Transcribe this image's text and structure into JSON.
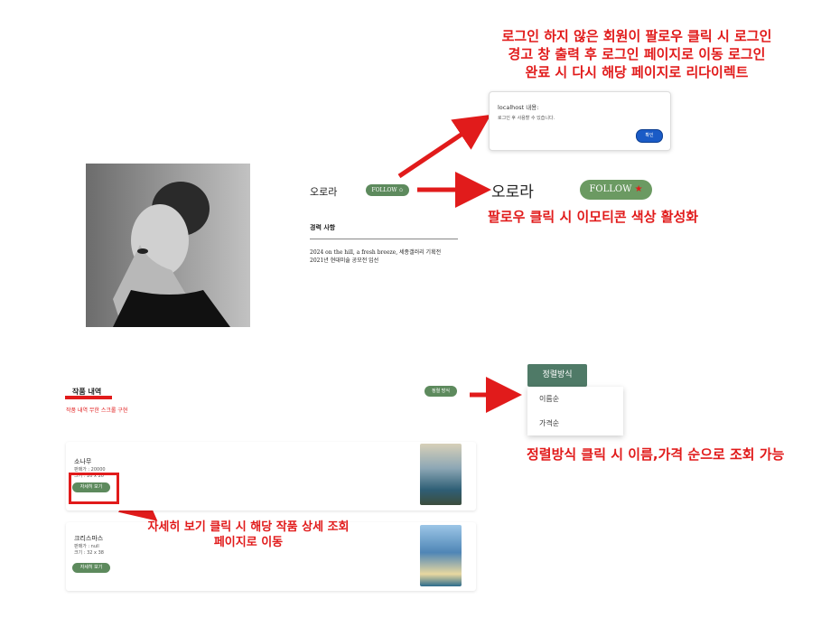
{
  "notes": {
    "login_warning": [
      "로그인 하지 않은 회원이 팔로우 클릭 시 로그인",
      "경고 창 출력 후 로그인 페이지로 이동 로그인",
      "완료 시 다시 해당 페이지로 리다이렉트"
    ],
    "follow_activate": "팔로우 클릭 시 이모티콘 색상 활성화",
    "sort_note": "정렬방식 클릭 시 이름,가격 순으로 조회 가능",
    "detail_note": [
      "자세히 보기 클릭 시 해당 작품 상세 조회",
      "페이지로 이동"
    ]
  },
  "profile": {
    "name": "오로라",
    "follow_label": "FOLLOW ✩",
    "career_heading": "경력 사항",
    "career_lines": [
      "2024 on the hill, a fresh breeze, 세종갤러리 기획전",
      "2021년 현대미술 공모전 입선"
    ]
  },
  "modal": {
    "title": "localhost 내용:",
    "message": "로그인 후 사용할 수 있습니다.",
    "confirm": "확인"
  },
  "follow_active": {
    "name": "오로라",
    "label": "FOLLOW",
    "star": "★"
  },
  "works": {
    "title": "작품 내역",
    "subtitle": "작품 내역 무한 스크롤 구현",
    "sort_small": "정렬 방식",
    "sort_button": "정렬방식",
    "sort_options": [
      "이름순",
      "가격순"
    ],
    "items": [
      {
        "title": "소나무",
        "meta1": "판매가 : 20000",
        "meta2": "크기 : 20 x 20",
        "button": "자세히 보기"
      },
      {
        "title": "크리스마스",
        "meta1": "판매가 : null",
        "meta2": "크기 : 32 x 38",
        "button": "자세히 보기"
      }
    ]
  },
  "colors": {
    "accent_red": "#e11b1b",
    "green": "#5d8a5d",
    "sort_green": "#4f7a67",
    "modal_blue": "#1a5bc6"
  }
}
